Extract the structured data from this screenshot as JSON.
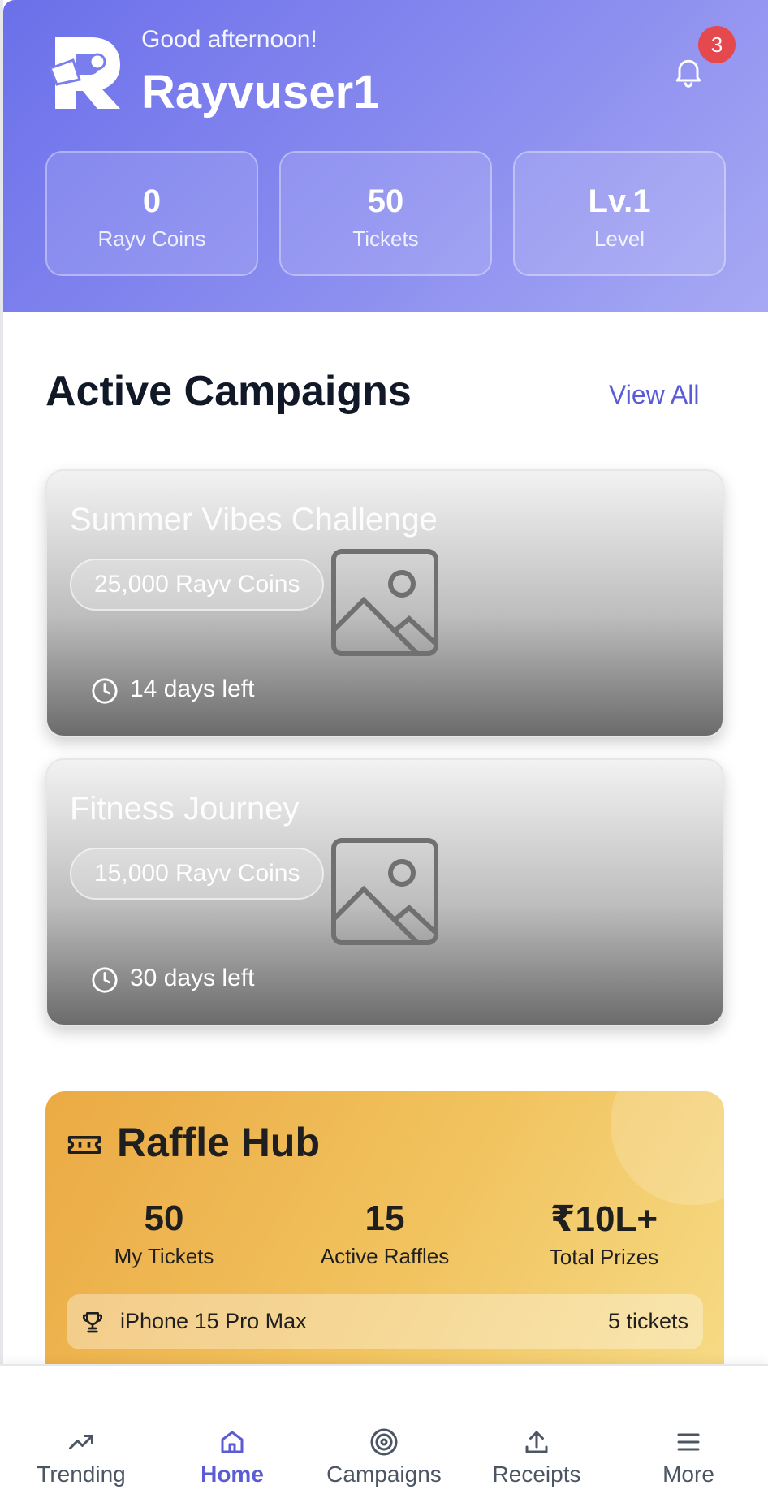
{
  "header": {
    "greeting": "Good afternoon!",
    "username": "Rayvuser1",
    "notification_count": "3",
    "stats": [
      {
        "value": "0",
        "label": "Rayv Coins"
      },
      {
        "value": "50",
        "label": "Tickets"
      },
      {
        "value": "Lv.1",
        "label": "Level"
      }
    ],
    "colors": {
      "gradient_start": "#6b70ea",
      "gradient_end": "#a7a9f4",
      "badge": "#e5484d"
    }
  },
  "campaigns": {
    "title": "Active Campaigns",
    "view_all_label": "View All",
    "items": [
      {
        "title": "Summer Vibes Challenge",
        "reward": "25,000 Rayv Coins",
        "days_left": "14 days left",
        "image_icon": "image-placeholder-icon"
      },
      {
        "title": "Fitness Journey",
        "reward": "15,000 Rayv Coins",
        "days_left": "30 days left",
        "image_icon": "image-placeholder-icon"
      }
    ]
  },
  "raffle": {
    "title": "Raffle Hub",
    "icon": "ticket-icon",
    "stats": [
      {
        "value": "50",
        "label": "My Tickets"
      },
      {
        "value": "15",
        "label": "Active Raffles"
      },
      {
        "value": "₹10L+",
        "label": "Total Prizes"
      }
    ],
    "prize": {
      "icon": "trophy-icon",
      "name": "iPhone 15 Pro Max",
      "tickets": "5 tickets"
    }
  },
  "nav": {
    "active": "Home",
    "accent_color": "#5b5bd6",
    "items": [
      {
        "label": "Trending",
        "icon": "trending-icon"
      },
      {
        "label": "Home",
        "icon": "home-icon"
      },
      {
        "label": "Campaigns",
        "icon": "target-icon"
      },
      {
        "label": "Receipts",
        "icon": "upload-icon"
      },
      {
        "label": "More",
        "icon": "menu-icon"
      }
    ]
  }
}
